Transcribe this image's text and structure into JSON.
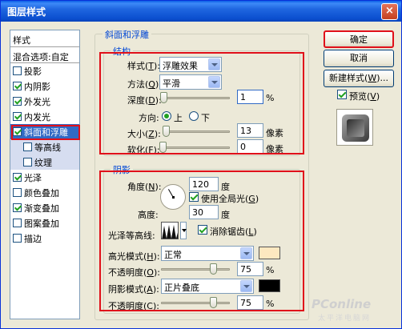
{
  "window": {
    "title": "图层样式",
    "close_glyph": "×"
  },
  "stylelist": {
    "header": "样式",
    "mix": "混合选项:自定",
    "items": [
      {
        "label": "投影",
        "checked": false
      },
      {
        "label": "内阴影",
        "checked": true
      },
      {
        "label": "外发光",
        "checked": true
      },
      {
        "label": "内发光",
        "checked": true
      },
      {
        "label": "斜面和浮雕",
        "checked": true,
        "selected": true
      },
      {
        "label": "等高线",
        "checked": false,
        "sub": true
      },
      {
        "label": "纹理",
        "checked": false,
        "sub": true
      },
      {
        "label": "光泽",
        "checked": true
      },
      {
        "label": "颜色叠加",
        "checked": false
      },
      {
        "label": "渐变叠加",
        "checked": true
      },
      {
        "label": "图案叠加",
        "checked": false
      },
      {
        "label": "描边",
        "checked": false
      }
    ]
  },
  "bevel": {
    "title": "斜面和浮雕",
    "structure": {
      "title": "结构",
      "style_label": "样式(",
      "style_key": "T",
      "style_value": "浮雕效果",
      "method_label": "方法(",
      "method_key": "Q",
      "method_value": "平滑",
      "depth_label": "深度(",
      "depth_key": "D",
      "depth_value": "1",
      "depth_unit": "%",
      "depth_pos": 0.01,
      "direction_label": "方向:",
      "dir_up": "上",
      "dir_down": "下",
      "size_label": "大小(",
      "size_key": "Z",
      "size_value": "13",
      "size_unit": "像素",
      "size_pos": 0.05,
      "soften_label": "软化(",
      "soften_key": "F",
      "soften_value": "0",
      "soften_unit": "像素",
      "soften_pos": 0.0
    },
    "shading": {
      "title": "阴影",
      "angle_label": "角度(",
      "angle_key": "N",
      "angle_value": "120",
      "angle_unit": "度",
      "global_light": "使用全局光(",
      "global_light_key": "G",
      "altitude_label": "高度:",
      "altitude_value": "30",
      "altitude_unit": "度",
      "gloss_label": "光泽等高线:",
      "antialias": "消除锯齿(",
      "antialias_key": "L",
      "highlight_mode_label": "高光模式(",
      "highlight_mode_key": "H",
      "highlight_mode_value": "正常",
      "highlight_color": "#fde8c0",
      "opacity_label": "不透明度(",
      "opacity_key": "O",
      "highlight_opacity": "75",
      "opacity_unit": "%",
      "highlight_opacity_pos": 0.75,
      "shadow_mode_label": "阴影模式(",
      "shadow_mode_key": "A",
      "shadow_mode_value": "正片叠底",
      "shadow_color": "#000000",
      "opacity2_key": "C",
      "shadow_opacity": "75",
      "shadow_opacity_pos": 0.75
    }
  },
  "buttons": {
    "ok": "确定",
    "cancel": "取消",
    "new_style": "新建样式(",
    "new_style_key": "W",
    "new_style_tail": ")...",
    "preview": "预览(",
    "preview_key": "V"
  },
  "watermark": {
    "brand": "PConline",
    "sub": "太平洋电脑网"
  },
  "colors": {
    "accent": "#0046d5",
    "highlight_box": "#e0101a",
    "selection": "#316ac5"
  },
  "icons": {
    "close": "close-icon",
    "dial": "angle-dial-icon",
    "contour": "gloss-contour-icon"
  }
}
